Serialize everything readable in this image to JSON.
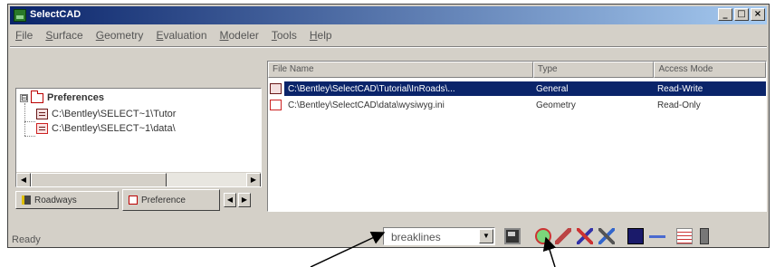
{
  "window": {
    "title": "SelectCAD",
    "buttons": [
      "_",
      "□",
      "×"
    ]
  },
  "menu": [
    "File",
    "Surface",
    "Geometry",
    "Evaluation",
    "Modeler",
    "Tools",
    "Help"
  ],
  "tree": {
    "root": "Preferences",
    "expander": "⊟",
    "children": [
      "C:\\Bentley\\SELECT~1\\Tutor",
      "C:\\Bentley\\SELECT~1\\data\\"
    ]
  },
  "tabs": [
    "Roadways",
    "Preference"
  ],
  "file_table": {
    "columns": [
      "File Name",
      "Type",
      "Access Mode"
    ],
    "rows": [
      {
        "name": "C:\\Bentley\\SelectCAD\\Tutorial\\InRoads\\...",
        "type": "General",
        "access": "Read-Write",
        "selected": true
      },
      {
        "name": "C:\\Bentley\\SelectCAD\\data\\wysiwyg.ini",
        "type": "Geometry",
        "access": "Read-Only",
        "selected": false
      }
    ]
  },
  "toolbar": {
    "combo_value": "breaklines",
    "icons": [
      "save-icon",
      "globe-icon",
      "pencil-icon",
      "cross-icon",
      "tools-icon",
      "color-icon",
      "line-style-icon",
      "properties-icon",
      "bar-icon"
    ]
  },
  "status": "Ready"
}
